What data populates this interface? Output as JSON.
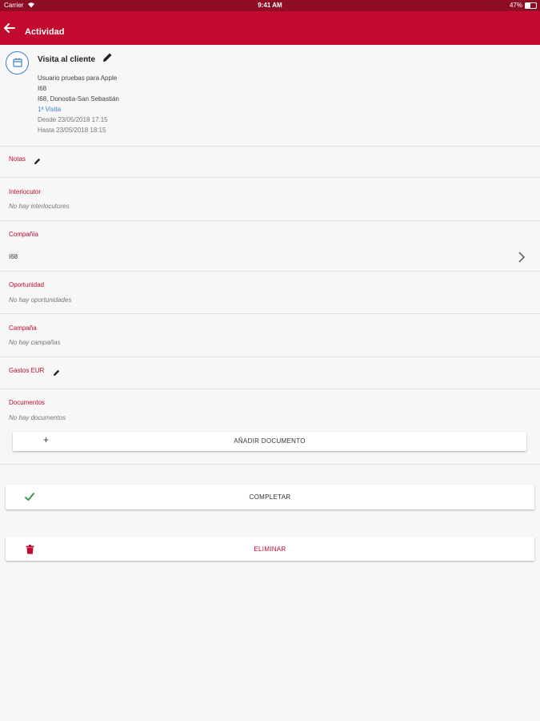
{
  "status_bar": {
    "carrier": "Carrier",
    "time": "9:41 AM",
    "battery": "47%",
    "battery_level": 0.47
  },
  "app_bar": {
    "title": "Actividad",
    "back_icon": "arrow-left-icon"
  },
  "activity": {
    "icon": "calendar-icon",
    "title": "Visita al cliente",
    "lines": [
      "Usuario pruebas para Apple",
      "I68",
      "I68, Donostia-San Sebastián",
      "1ª Visita",
      "Desde 23/05/2018 17:15",
      "Hasta 23/05/2018 18:15"
    ]
  },
  "sections": {
    "notas": {
      "label": "Notas"
    },
    "interlocutor": {
      "label": "Interlocutor",
      "empty": "No hay interlocutores"
    },
    "compania": {
      "label": "Compañía",
      "value": "I68"
    },
    "oportunidad": {
      "label": "Oportunidad",
      "empty": "No hay oportunidades"
    },
    "campana": {
      "label": "Campaña",
      "empty": "No hay campañas"
    },
    "gastos": {
      "label": "Gastos EUR"
    },
    "documentos": {
      "label": "Documentos",
      "empty": "No hay documentos"
    }
  },
  "buttons": {
    "add_document": "AÑADIR DOCUMENTO",
    "complete": "COMPLETAR",
    "delete": "ELIMINAR"
  },
  "colors": {
    "primary": "#c10a2e",
    "status_bar": "#8e0d25",
    "link": "#3b7fd0",
    "success": "#2e9e4a"
  }
}
